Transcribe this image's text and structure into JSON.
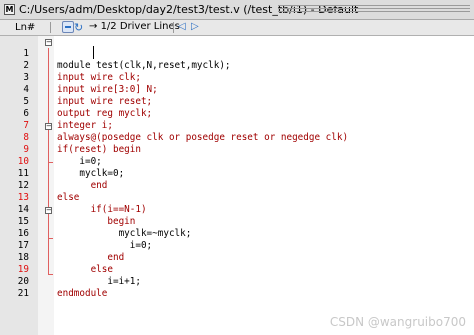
{
  "window": {
    "title": "C:/Users/adm/Desktop/day2/test3/test.v (/test_tb/i1) - Default"
  },
  "toolbar": {
    "ln_label": "Ln#",
    "driver_lines": "1/2 Driver Lines"
  },
  "editor": {
    "lines": [
      {
        "num": "1",
        "code": "module test(clk,N,reset,myclk);"
      },
      {
        "num": "2",
        "code": "input wire clk;"
      },
      {
        "num": "3",
        "code": "input wire[3:0] N;"
      },
      {
        "num": "4",
        "code": "input wire reset;"
      },
      {
        "num": "5",
        "code": "output reg myclk;"
      },
      {
        "num": "6",
        "code": "integer i;"
      },
      {
        "num": "7",
        "code": "always@(posedge clk or posedge reset or negedge clk)"
      },
      {
        "num": "8",
        "code": "if(reset) begin"
      },
      {
        "num": "9",
        "code": "    i=0;"
      },
      {
        "num": "10",
        "code": "    myclk=0;"
      },
      {
        "num": "11",
        "code": "      end"
      },
      {
        "num": "12",
        "code": "else"
      },
      {
        "num": "13",
        "code": "      if(i==N-1)"
      },
      {
        "num": "14",
        "code": "         begin"
      },
      {
        "num": "15",
        "code": "           myclk=~myclk;"
      },
      {
        "num": "16",
        "code": "             i=0;"
      },
      {
        "num": "17",
        "code": "         end"
      },
      {
        "num": "18",
        "code": "      else"
      },
      {
        "num": "19",
        "code": "         i=i+1;"
      },
      {
        "num": "20",
        "code": "endmodule"
      },
      {
        "num": "21",
        "code": ""
      }
    ]
  },
  "watermark": "CSDN @wangruibo700",
  "colors": {
    "keyword": "#a00000",
    "breakpoint_line": "#e01010",
    "fold_line": "#e06060"
  }
}
